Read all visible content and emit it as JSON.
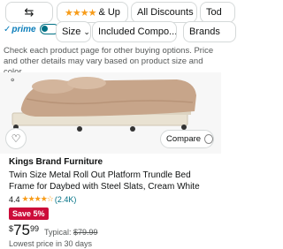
{
  "filters": {
    "rating_label": "& Up",
    "discounts_label": "All Discounts",
    "today_label": "Tod",
    "size_label": "Size",
    "included_label": "Included Compo...",
    "brands_label": "Brands",
    "prime_label": "prime"
  },
  "note": "Check each product page for other buying options. Price and other details may vary based on product size and color.",
  "product": {
    "compare_label": "Compare",
    "brand": "Kings Brand Furniture",
    "title": "Twin Size Metal Roll Out Platform Trundle Bed Frame for Daybed with Steel Slats, Cream White",
    "rating": "4.4",
    "rating_count": "(2.4K)",
    "badge": "Save 5%",
    "price_currency": "$",
    "price_whole": "75",
    "price_fraction": "99",
    "typical_label": "Typical:",
    "typical_price": "$79.99",
    "lowest_note": "Lowest price in 30 days"
  },
  "colors": {
    "accent": "#007185",
    "badge": "#CC0C39",
    "stars": "#F79C1A",
    "bed_frame": "#E9E2D2",
    "bedding": "#C7A58A"
  },
  "icons": [
    "filter-icon",
    "star-icon",
    "chevron-down-icon",
    "prime-check-icon",
    "toggle-switch",
    "carousel-dot-icon",
    "heart-icon",
    "compare-checkbox-icon"
  ]
}
